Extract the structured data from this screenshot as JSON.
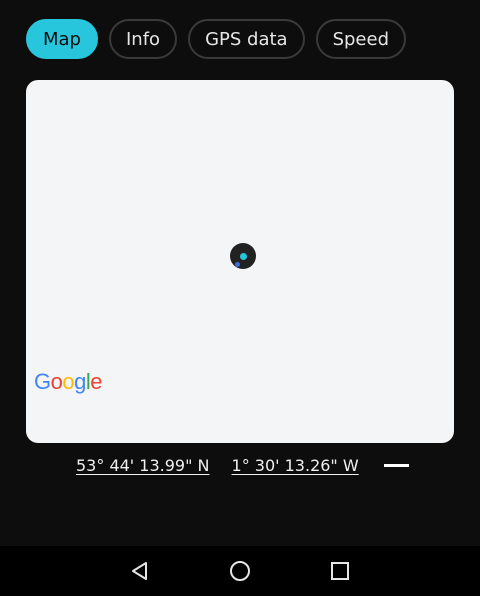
{
  "tabs": [
    {
      "label": "Map"
    },
    {
      "label": "Info"
    },
    {
      "label": "GPS data"
    },
    {
      "label": "Speed"
    }
  ],
  "map": {
    "attribution": {
      "letters": [
        "G",
        "o",
        "o",
        "g",
        "l",
        "e"
      ]
    }
  },
  "coordinates": {
    "latitude": "53° 44' 13.99\" N",
    "longitude": "1° 30' 13.26\" W"
  },
  "colors": {
    "accent": "#28c6dc",
    "background": "#0d0d0d",
    "map_bg": "#f4f5f7"
  },
  "navbar": {
    "icons": [
      "back-icon",
      "home-icon",
      "recents-icon"
    ]
  }
}
